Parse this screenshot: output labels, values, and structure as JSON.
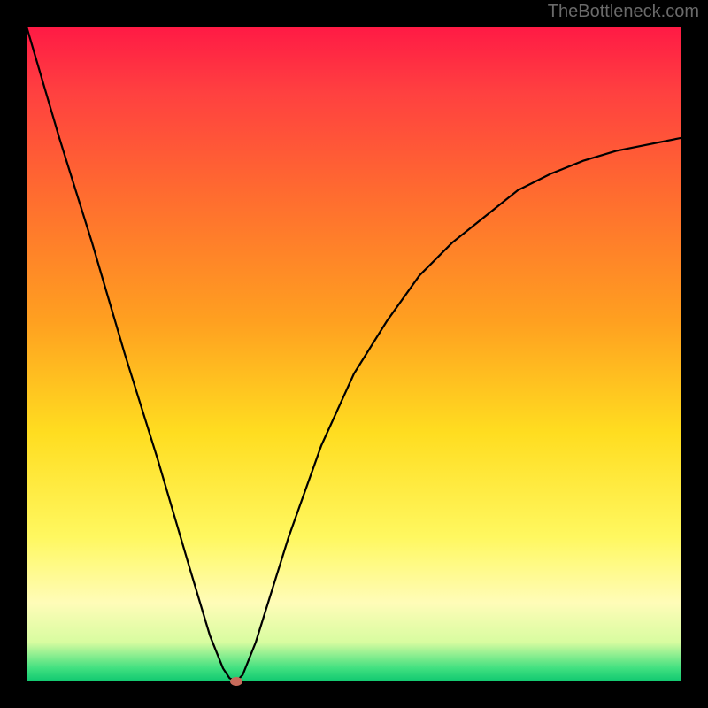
{
  "watermark": "TheBottleneck.com",
  "chart_data": {
    "type": "line",
    "title": "",
    "xlabel": "",
    "ylabel": "",
    "xlim": [
      0,
      100
    ],
    "ylim": [
      0,
      100
    ],
    "series": [
      {
        "name": "bottleneck-curve",
        "x": [
          0,
          5,
          10,
          15,
          20,
          25,
          28,
          30,
          31,
          32,
          33,
          35,
          40,
          45,
          50,
          55,
          60,
          65,
          70,
          75,
          80,
          85,
          90,
          95,
          100
        ],
        "y": [
          100,
          83,
          67,
          50,
          34,
          17,
          7,
          2,
          0.5,
          0,
          1,
          6,
          22,
          36,
          47,
          55,
          62,
          67,
          71,
          75,
          77.5,
          79.5,
          81,
          82,
          83
        ]
      }
    ],
    "marker": {
      "x": 32,
      "y": 0,
      "name": "optimal-point"
    },
    "gradient_stops": [
      {
        "pos": 0,
        "color": "#ff1a45"
      },
      {
        "pos": 25,
        "color": "#ff6a30"
      },
      {
        "pos": 62,
        "color": "#ffdd20"
      },
      {
        "pos": 88,
        "color": "#fffcb8"
      },
      {
        "pos": 100,
        "color": "#10c870"
      }
    ]
  }
}
